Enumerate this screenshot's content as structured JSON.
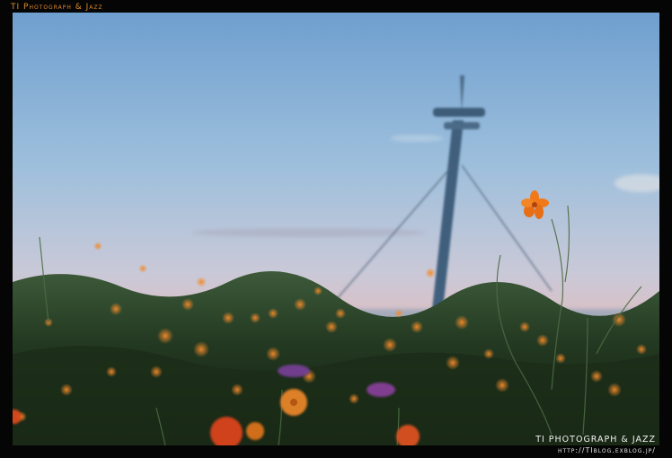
{
  "watermark": {
    "top_left": "TI Photograph & Jazz",
    "bottom_right_title": "TI PHOTOGRAPH & JAZZ",
    "bottom_right_url": "http://TIblog.exblog.jp/"
  },
  "colors": {
    "frame": "#050505",
    "top_brand": "#e08a2e",
    "sky_top": "#7aa9d6",
    "sky_bottom": "#e9b9b0",
    "flower": "#f07a1a"
  }
}
